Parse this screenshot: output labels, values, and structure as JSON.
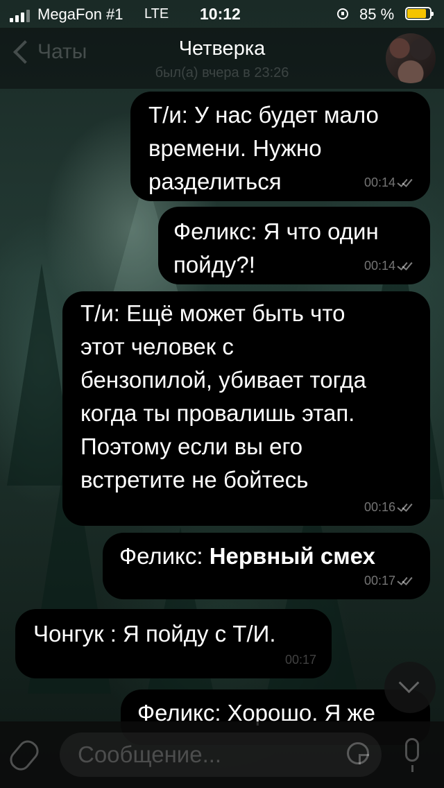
{
  "status_bar": {
    "carrier": "MegaFon #1",
    "network": "LTE",
    "time": "10:12",
    "battery_percent": "85 %",
    "battery_level": 0.85,
    "battery_color": "#f5c400"
  },
  "header": {
    "back_label": "Чаты",
    "title": "Четверка",
    "subtitle": "был(а) вчера в 23:26"
  },
  "messages": [
    {
      "sender": "Т/и",
      "text": "Т/и: У нас будет мало\nвремени. Нужно\nразделиться",
      "time": "00:14",
      "direction": "out",
      "read": true
    },
    {
      "sender": "Феликс",
      "text": "Феликс: Я что один\nпойду?!",
      "time": "00:14",
      "direction": "out",
      "read": true
    },
    {
      "sender": "Т/и",
      "text": "Т/и: Ещё может быть что\nэтот человек с\nбензопилой, убивает тогда\nкогда ты провалишь этап.\nПоэтому если вы его\nвстретите не бойтесь",
      "time": "00:16",
      "direction": "out",
      "read": true
    },
    {
      "sender": "Феликс",
      "prefix": "Феликс: ",
      "bold": "Нервный смех",
      "time": "00:17",
      "direction": "out",
      "read": true
    },
    {
      "sender": "Чонгук",
      "text": "Чонгук : Я пойду с Т/И.",
      "time": "00:17",
      "direction": "in"
    },
    {
      "sender": "Феликс",
      "text": "Феликс: Хорошо. Я же",
      "direction": "out"
    }
  ],
  "composer": {
    "placeholder": "Сообщение..."
  },
  "icons": {
    "back": "chevron-left-icon",
    "attach": "paperclip-icon",
    "sticker": "sticker-icon",
    "mic": "microphone-icon",
    "scroll_down": "chevron-down-icon"
  }
}
